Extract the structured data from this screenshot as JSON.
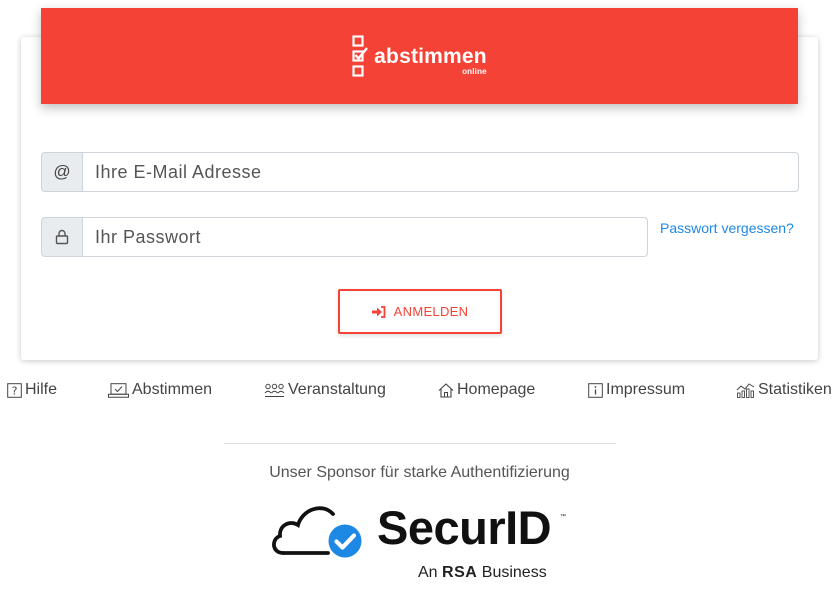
{
  "header": {
    "logo_text": "abstimmen",
    "logo_subtext": "online",
    "background_color": "#f44336"
  },
  "form": {
    "email": {
      "icon": "at-icon",
      "icon_text": "@",
      "placeholder": "Ihre E-Mail Adresse",
      "value": ""
    },
    "password": {
      "icon": "lock-icon",
      "placeholder": "Ihr Passwort",
      "value": ""
    },
    "forgot_link": "Passwort vergessen?",
    "login_button": {
      "icon": "sign-in-icon",
      "label": "ANMELDEN"
    }
  },
  "nav": {
    "items": [
      {
        "icon": "help-icon",
        "label": "Hilfe"
      },
      {
        "icon": "ballot-icon",
        "label": "Abstimmen"
      },
      {
        "icon": "group-icon",
        "label": "Veranstaltung"
      },
      {
        "icon": "home-icon",
        "label": "Homepage"
      },
      {
        "icon": "info-icon",
        "label": "Impressum"
      },
      {
        "icon": "stats-icon",
        "label": "Statistiken"
      }
    ]
  },
  "sponsor": {
    "text": "Unser Sponsor für starke Authentifizierung",
    "logo_word": "SecurID",
    "trademark": "™",
    "byline_prefix": "An",
    "byline_brand": "RSA",
    "byline_suffix": "Business",
    "accent_color": "#1e88e5"
  }
}
